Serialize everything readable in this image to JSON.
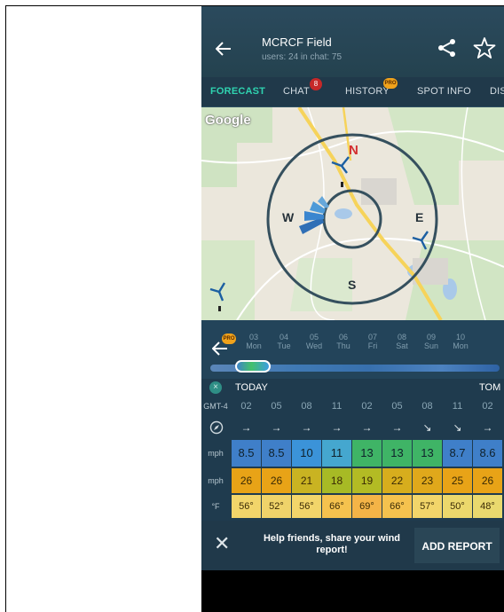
{
  "header": {
    "title": "MCRCF Field",
    "subtitle": "users: 24 in chat: 75"
  },
  "tabs": [
    {
      "label": "FORECAST"
    },
    {
      "label": "CHAT",
      "badge": "8"
    },
    {
      "label": "HISTORY",
      "badge": "PRO"
    },
    {
      "label": "SPOT INFO"
    },
    {
      "label": "DIS"
    }
  ],
  "map": {
    "attribution": "Google",
    "compass": {
      "n": "N",
      "e": "E",
      "s": "S",
      "w": "W"
    }
  },
  "timeline": {
    "pro_badge": "PRO",
    "days": [
      {
        "num": "03",
        "name": "Mon"
      },
      {
        "num": "04",
        "name": "Tue"
      },
      {
        "num": "05",
        "name": "Wed"
      },
      {
        "num": "06",
        "name": "Thu"
      },
      {
        "num": "07",
        "name": "Fri"
      },
      {
        "num": "08",
        "name": "Sat"
      },
      {
        "num": "09",
        "name": "Sun"
      },
      {
        "num": "10",
        "name": "Mon"
      }
    ]
  },
  "forecast": {
    "today_label": "TODAY",
    "tomorrow_label": "TOM",
    "timezone": "GMT-4",
    "hours": [
      "02",
      "05",
      "08",
      "11",
      "02",
      "05",
      "08",
      "11",
      "02"
    ],
    "wind_direction": [
      "→",
      "→",
      "→",
      "→",
      "→",
      "→",
      "↘",
      "↘",
      "→"
    ],
    "wind_unit": "mph",
    "wind_speed": [
      "8.5",
      "8.5",
      "10",
      "11",
      "13",
      "13",
      "13",
      "8.7",
      "8.6"
    ],
    "wind_speed_colors": [
      "#3f7fc9",
      "#3f7fc9",
      "#3b93d9",
      "#45a7cf",
      "#3fb466",
      "#3fb466",
      "#3fb466",
      "#3f7fc9",
      "#3f7fc9"
    ],
    "gust_unit": "mph",
    "gusts": [
      "26",
      "26",
      "21",
      "18",
      "19",
      "22",
      "23",
      "25",
      "26"
    ],
    "gust_colors": [
      "#e8a317",
      "#e8a317",
      "#c9b322",
      "#a7ba25",
      "#b3bb24",
      "#d7ad1d",
      "#e0a81b",
      "#e8a317",
      "#e8a317"
    ],
    "temp_unit": "°F",
    "temps": [
      "56°",
      "52°",
      "56°",
      "66°",
      "69°",
      "66°",
      "57°",
      "50°",
      "48°"
    ],
    "temp_colors": [
      "#f2d56a",
      "#efd36a",
      "#f2d56a",
      "#f5c24e",
      "#f4b447",
      "#f5c24e",
      "#f2d56a",
      "#ecd86c",
      "#e9d96e"
    ]
  },
  "report": {
    "text": "Help friends, share your wind report!",
    "button": "ADD REPORT"
  }
}
